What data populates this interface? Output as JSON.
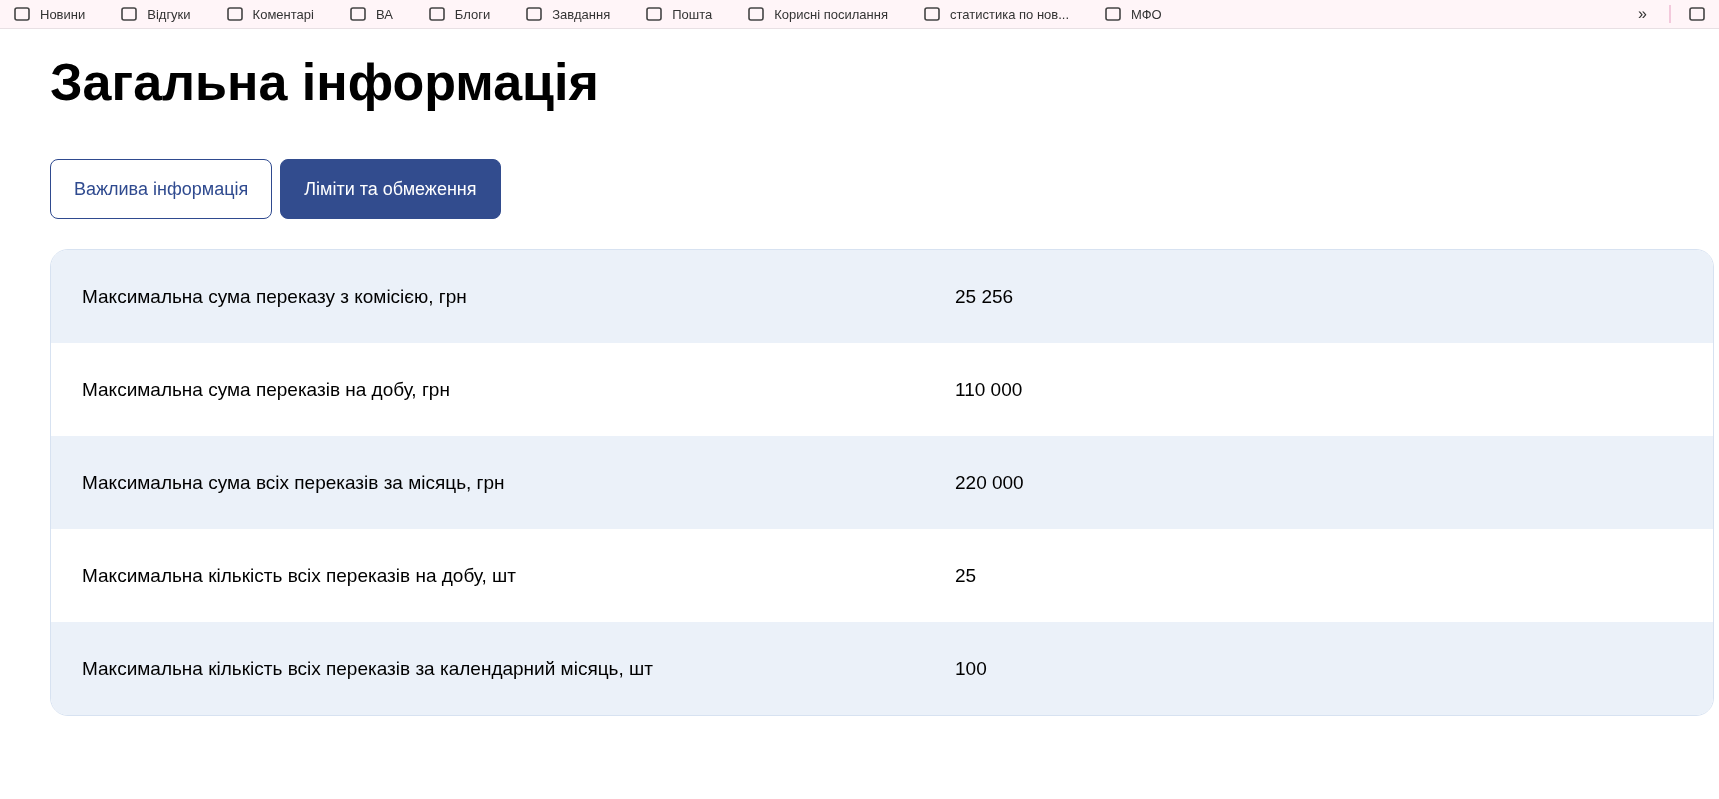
{
  "bookmarks": {
    "items": [
      "Новини",
      "Відгуки",
      "Коментарі",
      "ВА",
      "Блоги",
      "Завдання",
      "Пошта",
      "Корисні посилання",
      "статистика по нов...",
      "МФО"
    ],
    "overflow": "»"
  },
  "title": "Загальна інформація",
  "tabs": [
    {
      "label": "Важлива інформація",
      "selected": false
    },
    {
      "label": "Ліміти та обмеження",
      "selected": true
    }
  ],
  "table": {
    "rows": [
      {
        "label": "Максимальна сума переказу з комісією, грн",
        "value": "25 256"
      },
      {
        "label": "Максимальна сума переказів на добу, грн",
        "value": "110 000"
      },
      {
        "label": "Максимальна сума всіх переказів за місяць, грн",
        "value": "220 000"
      },
      {
        "label": "Максимальна кількість всіх переказів на добу, шт",
        "value": "25"
      },
      {
        "label": "Максимальна кількість всіх переказів за календарний місяць, шт",
        "value": "100"
      }
    ]
  }
}
